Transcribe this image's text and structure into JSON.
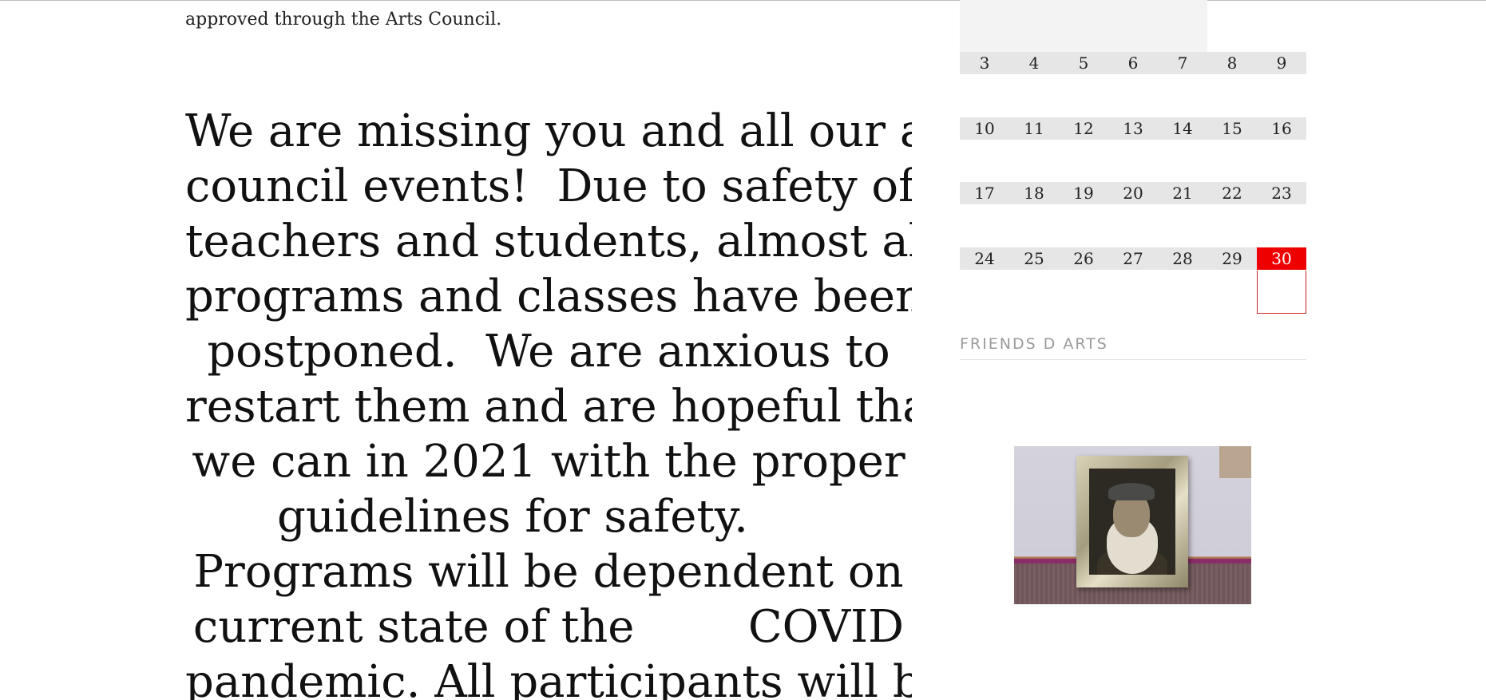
{
  "main": {
    "cut_line": "approved through the Arts Council.",
    "intro": "approved through the Arts Council.",
    "message_lines": [
      "We are missing you and all our arts",
      "council events!  Due to safety of our",
      "teachers and students, almost all",
      "programs and classes have been",
      "postponed.  We are anxious to",
      "restart them and are hopeful that",
      "we can in 2021 with the proper",
      "guidelines for safety.        ",
      "Programs will be dependent on",
      "current state of the        COVID",
      "pandemic. All participants will be"
    ]
  },
  "calendar": {
    "weeks": [
      [
        "3",
        "4",
        "5",
        "6",
        "7",
        "8",
        "9"
      ],
      [
        "10",
        "11",
        "12",
        "13",
        "14",
        "15",
        "16"
      ],
      [
        "17",
        "18",
        "19",
        "20",
        "21",
        "22",
        "23"
      ],
      [
        "24",
        "25",
        "26",
        "27",
        "28",
        "29",
        "30"
      ]
    ],
    "today": "30",
    "today_color": "#ee0000"
  },
  "sidebar": {
    "widget_title": "FRIENDS D ARTS",
    "photo_icon": "framed-portrait-photo"
  }
}
